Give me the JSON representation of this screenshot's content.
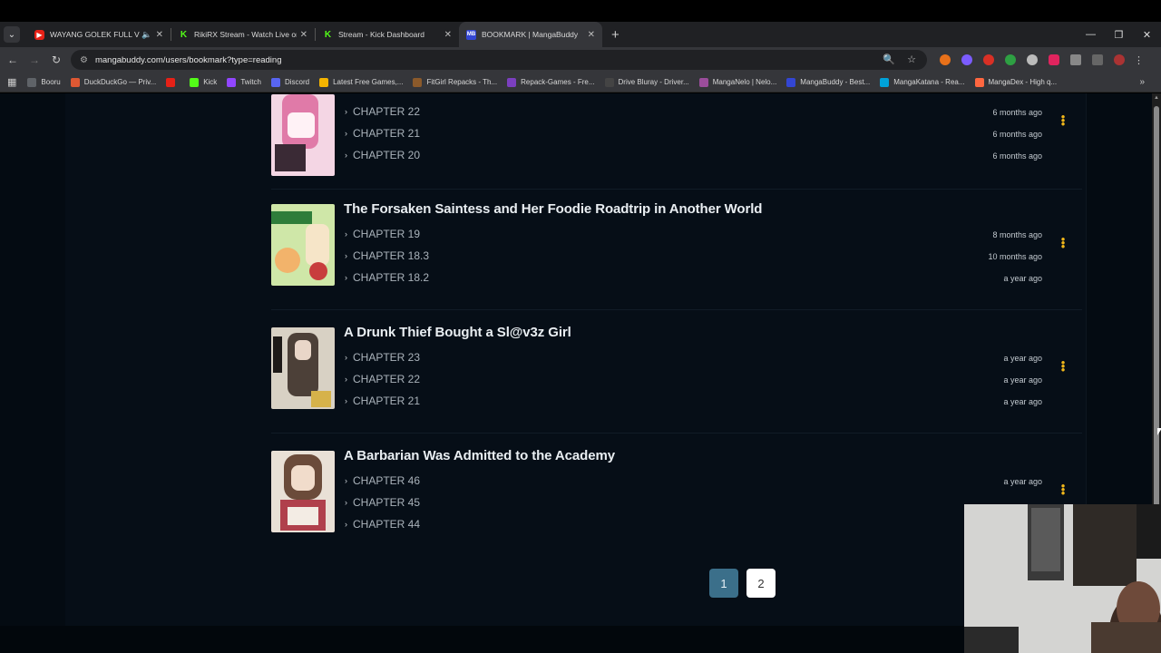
{
  "browser": {
    "tabs": [
      {
        "title": "WAYANG GOLEK FULL VIDE",
        "favicon": "youtube-icon",
        "audio": true,
        "active": false
      },
      {
        "title": "RikiRX Stream - Watch Live on K",
        "favicon": "kick-icon",
        "active": false
      },
      {
        "title": "Stream - Kick Dashboard",
        "favicon": "kick-icon",
        "active": false
      },
      {
        "title": "BOOKMARK | MangaBuddy",
        "favicon": "mangabuddy-icon",
        "active": true
      }
    ],
    "new_tab_label": "+",
    "url": "mangabuddy.com/users/bookmark?type=reading",
    "bookmarks": [
      {
        "label": "Booru",
        "icon": "folder-icon",
        "color": "#5f6368"
      },
      {
        "label": "DuckDuckGo — Priv...",
        "icon": "duckduckgo-icon",
        "color": "#de5833"
      },
      {
        "label": "",
        "icon": "youtube-icon",
        "color": "#e62117"
      },
      {
        "label": "Kick",
        "icon": "kick-icon",
        "color": "#53fc18"
      },
      {
        "label": "Twitch",
        "icon": "twitch-icon",
        "color": "#9146ff"
      },
      {
        "label": "Discord",
        "icon": "discord-icon",
        "color": "#5865f2"
      },
      {
        "label": "Latest Free Games,...",
        "icon": "game-icon",
        "color": "#f4b400"
      },
      {
        "label": "FitGirl Repacks - Th...",
        "icon": "fitgirl-icon",
        "color": "#8b5a2b"
      },
      {
        "label": "Repack-Games - Fre...",
        "icon": "repack-icon",
        "color": "#7b3fbf"
      },
      {
        "label": "Drive Bluray - Driver...",
        "icon": "drive-icon",
        "color": "#444"
      },
      {
        "label": "MangaNelo | Nelo...",
        "icon": "manganelo-icon",
        "color": "#9b4d9b"
      },
      {
        "label": "MangaBuddy - Best...",
        "icon": "mangabuddy-icon",
        "color": "#3346d3"
      },
      {
        "label": "MangaKatana - Rea...",
        "icon": "mangakatana-icon",
        "color": "#00a2d9"
      },
      {
        "label": "MangaDex - High q...",
        "icon": "mangadex-icon",
        "color": "#ff6740"
      }
    ]
  },
  "entries": [
    {
      "title": "",
      "cover_colors": [
        "#f4d6e4",
        "#e07aa8",
        "#3a2a35"
      ],
      "chapters": [
        {
          "label": "CHAPTER 22",
          "time": "6 months ago"
        },
        {
          "label": "CHAPTER 21",
          "time": "6 months ago"
        },
        {
          "label": "CHAPTER 20",
          "time": "6 months ago"
        }
      ]
    },
    {
      "title": "The Forsaken Saintess and Her Foodie Roadtrip in Another World",
      "cover_colors": [
        "#cfe7a8",
        "#f2b36b",
        "#c83d3d"
      ],
      "chapters": [
        {
          "label": "CHAPTER 19",
          "time": "8 months ago"
        },
        {
          "label": "CHAPTER 18.3",
          "time": "10 months ago"
        },
        {
          "label": "CHAPTER 18.2",
          "time": "a year ago"
        }
      ]
    },
    {
      "title": "A Drunk Thief Bought a Sl@v3z Girl",
      "cover_colors": [
        "#d8d1c4",
        "#4c4038",
        "#1e1a18"
      ],
      "chapters": [
        {
          "label": "CHAPTER 23",
          "time": "a year ago"
        },
        {
          "label": "CHAPTER 22",
          "time": "a year ago"
        },
        {
          "label": "CHAPTER 21",
          "time": "a year ago"
        }
      ]
    },
    {
      "title": "A Barbarian Was Admitted to the Academy",
      "cover_colors": [
        "#e9e0d6",
        "#6b4b3a",
        "#b0404c"
      ],
      "chapters": [
        {
          "label": "CHAPTER 46",
          "time": "a year ago"
        },
        {
          "label": "CHAPTER 45",
          "time": ""
        },
        {
          "label": "CHAPTER 44",
          "time": ""
        }
      ]
    }
  ],
  "pagination": {
    "pages": [
      "1",
      "2"
    ],
    "current": "1"
  },
  "colors": {
    "accent_dots": "#f1b71a",
    "page_current": "#3b6f8a",
    "background": "#040b12"
  }
}
